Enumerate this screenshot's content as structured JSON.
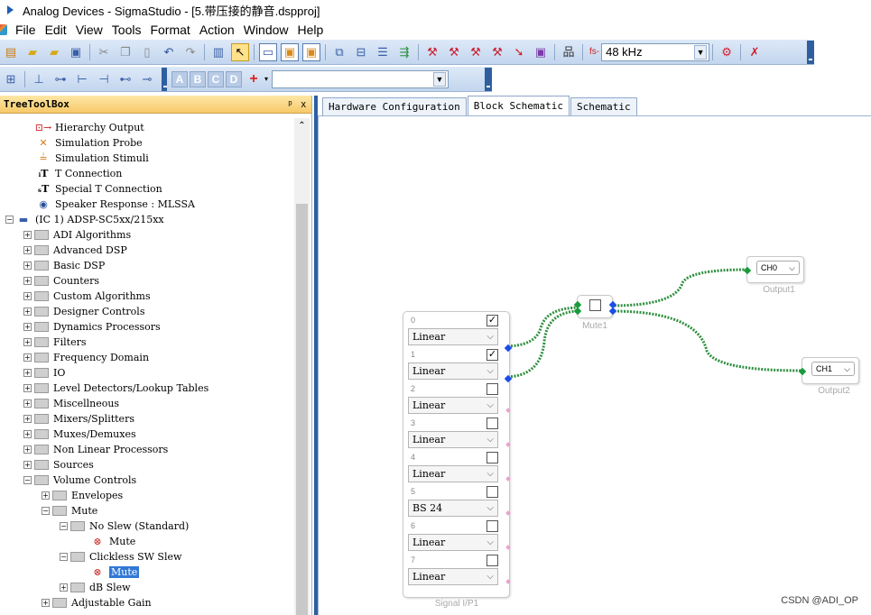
{
  "window": {
    "title": "Analog Devices - SigmaStudio - [5.带压接的静音.dspproj]"
  },
  "menu": [
    "File",
    "Edit",
    "View",
    "Tools",
    "Format",
    "Action",
    "Window",
    "Help"
  ],
  "toolbar": {
    "sample_rate_label": "fs-",
    "sample_rate": "48 kHz",
    "align_letters": [
      "A",
      "B",
      "C",
      "D"
    ],
    "add_glyph": "+"
  },
  "tree": {
    "header": "TreeToolBox",
    "pin_glyph": "ᵖ",
    "close_glyph": "x",
    "items": [
      {
        "label": "Hierarchy Output",
        "icon": "hierarchy-output-icon"
      },
      {
        "label": "Simulation Probe",
        "icon": "probe-icon"
      },
      {
        "label": "Simulation Stimuli",
        "icon": "stimuli-icon"
      },
      {
        "label": "T Connection",
        "icon": "t-connection-icon"
      },
      {
        "label": "Special T Connection",
        "icon": "special-t-icon"
      },
      {
        "label": "Speaker Response : MLSSA",
        "icon": "speaker-icon"
      },
      {
        "label": "(IC 1) ADSP-SC5xx/215xx",
        "icon": "chip-icon"
      },
      {
        "label": "ADI Algorithms"
      },
      {
        "label": "Advanced DSP"
      },
      {
        "label": "Basic DSP"
      },
      {
        "label": "Counters"
      },
      {
        "label": "Custom Algorithms"
      },
      {
        "label": "Designer Controls"
      },
      {
        "label": "Dynamics Processors"
      },
      {
        "label": "Filters"
      },
      {
        "label": "Frequency Domain"
      },
      {
        "label": "IO"
      },
      {
        "label": "Level Detectors/Lookup Tables"
      },
      {
        "label": "Miscellneous"
      },
      {
        "label": "Mixers/Splitters"
      },
      {
        "label": "Muxes/Demuxes"
      },
      {
        "label": "Non Linear Processors"
      },
      {
        "label": "Sources"
      },
      {
        "label": "Volume Controls"
      },
      {
        "label": "Envelopes"
      },
      {
        "label": "Mute"
      },
      {
        "label": "No Slew (Standard)"
      },
      {
        "label": "Mute",
        "icon": "mute-icon"
      },
      {
        "label": "Clickless SW Slew"
      },
      {
        "label": "Mute",
        "icon": "mute-icon",
        "selected": true
      },
      {
        "label": "dB Slew"
      },
      {
        "label": "Adjustable Gain"
      }
    ]
  },
  "tabs": [
    "Hardware Configuration",
    "Block Schematic",
    "Schematic"
  ],
  "active_tab": "Block Schematic",
  "signal_input": {
    "caption": "Signal I/P1",
    "channels": [
      {
        "num": "0",
        "checked": true,
        "mode": "Linear"
      },
      {
        "num": "1",
        "checked": true,
        "mode": "Linear"
      },
      {
        "num": "2",
        "checked": false,
        "mode": "Linear"
      },
      {
        "num": "3",
        "checked": false,
        "mode": "Linear"
      },
      {
        "num": "4",
        "checked": false,
        "mode": "Linear"
      },
      {
        "num": "5",
        "checked": false,
        "mode": "BS 24"
      },
      {
        "num": "6",
        "checked": false,
        "mode": "Linear"
      },
      {
        "num": "7",
        "checked": false,
        "mode": "Linear"
      }
    ]
  },
  "mute_block": {
    "caption": "Mute1"
  },
  "outputs": [
    {
      "caption": "Output1",
      "channel": "CH0"
    },
    {
      "caption": "Output2",
      "channel": "CH1"
    }
  ],
  "check_glyph": "✓",
  "caret_glyph": "⌵",
  "watermark": "CSDN @ADI_OP",
  "colors": {
    "wire": "#2f8f3f",
    "pin_blue": "#1a4de6",
    "pin_green": "#1a9a3a",
    "selection": "#3178d6"
  }
}
